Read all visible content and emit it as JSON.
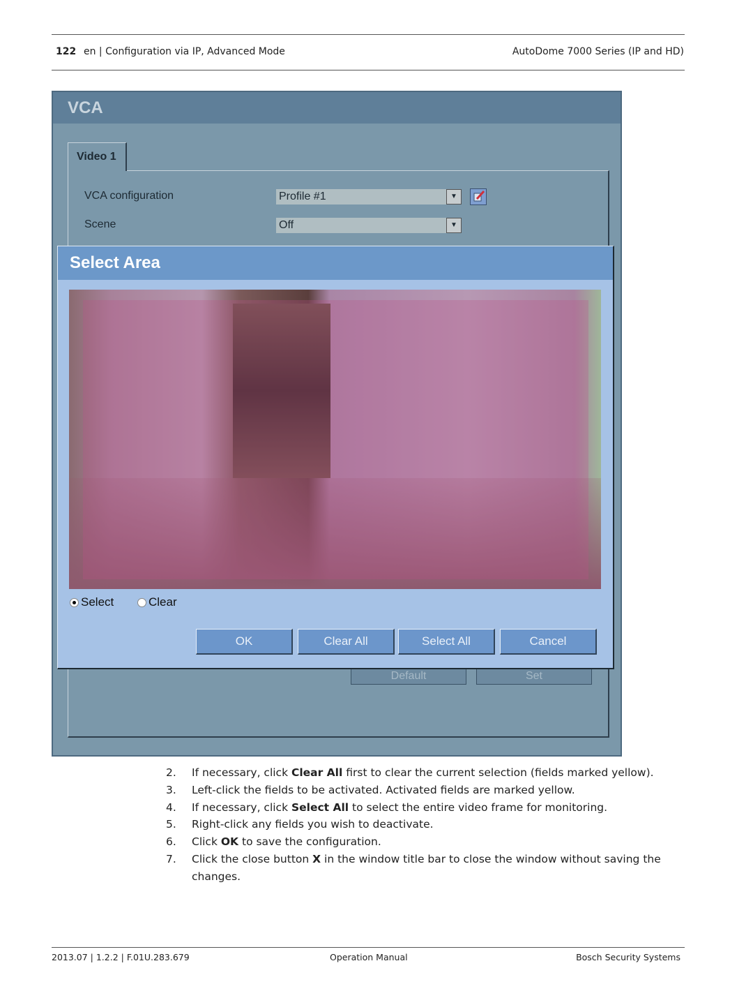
{
  "header": {
    "page_number": "122",
    "section": "en | Configuration via IP, Advanced Mode",
    "product": "AutoDome 7000 Series (IP and HD)"
  },
  "screenshot": {
    "window_title": "VCA",
    "tab": "Video 1",
    "vca_configuration": {
      "label": "VCA configuration",
      "value": "Profile #1",
      "icon": "edit-icon"
    },
    "scene": {
      "label": "Scene",
      "value": "Off"
    },
    "underlying_buttons": [
      "Default",
      "Set"
    ],
    "dialog": {
      "title": "Select Area",
      "radios": [
        {
          "label": "Select",
          "checked": true
        },
        {
          "label": "Clear",
          "checked": false
        }
      ],
      "buttons": [
        "OK",
        "Clear All",
        "Select All",
        "Cancel"
      ],
      "overlay_color": "#c0508a"
    }
  },
  "steps": [
    {
      "n": "2.",
      "parts": [
        "If necessary, click ",
        "Clear All",
        " first to clear the current selection (fields marked yellow)."
      ]
    },
    {
      "n": "3.",
      "parts": [
        "Left-click the fields to be activated. Activated fields are marked yellow.",
        "",
        ""
      ]
    },
    {
      "n": "4.",
      "parts": [
        "If necessary, click ",
        "Select All",
        " to select the entire video frame for monitoring."
      ]
    },
    {
      "n": "5.",
      "parts": [
        "Right-click any fields you wish to deactivate.",
        "",
        ""
      ]
    },
    {
      "n": "6.",
      "parts": [
        "Click ",
        "OK",
        " to save the configuration."
      ]
    },
    {
      "n": "7.",
      "parts": [
        "Click the close button ",
        "X",
        " in the window title bar to close the window without saving the changes."
      ]
    }
  ],
  "footer": {
    "left": "2013.07 | 1.2.2 | F.01U.283.679",
    "center": "Operation Manual",
    "right": "Bosch Security Systems"
  }
}
